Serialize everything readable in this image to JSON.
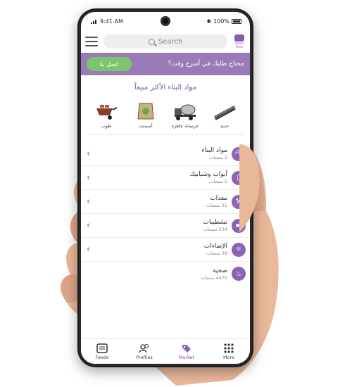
{
  "status": {
    "time": "9:41 AM",
    "battery": "100%"
  },
  "header": {
    "search_placeholder": "Search",
    "logo_text": "Sellers Point"
  },
  "promo": {
    "text": "محتاج طلبك في أسرع وقت؟",
    "cta": "اتصل بنا"
  },
  "best_sellers": {
    "title": "مواد البناء الأكثر مبيعاً",
    "items": [
      {
        "label": "حديد",
        "icon": "steel-bars-icon"
      },
      {
        "label": "خرسانة جاهزة",
        "icon": "concrete-mixer-icon"
      },
      {
        "label": "أسمنت",
        "icon": "cement-bag-icon"
      },
      {
        "label": "طوب",
        "icon": "bricks-wheelbarrow-icon"
      }
    ]
  },
  "categories": [
    {
      "title": "مواد البناء",
      "count": "2 منتجات",
      "icon": "excavator-icon"
    },
    {
      "title": "أبواب وشبابيك",
      "count": "5 منتجات",
      "icon": "door-icon"
    },
    {
      "title": "معدات",
      "count": "25 منتجات",
      "icon": "tools-icon"
    },
    {
      "title": "تشطيبات",
      "count": "334 منتجات",
      "icon": "paint-roller-icon"
    },
    {
      "title": "الإضاءات",
      "count": "38 منتجات",
      "icon": "lightbulb-icon"
    },
    {
      "title": "صحية",
      "count": "4470 منتجات",
      "icon": "faucet-icon"
    }
  ],
  "nav": [
    {
      "label": "Feeds",
      "icon": "feeds-icon"
    },
    {
      "label": "Profiles",
      "icon": "profiles-icon"
    },
    {
      "label": "Market",
      "icon": "market-tag-icon"
    },
    {
      "label": "More",
      "icon": "grid-more-icon"
    }
  ],
  "colors": {
    "accent": "#8a63b3",
    "banner": "#9b7bb7",
    "cta": "#7ec46e"
  }
}
